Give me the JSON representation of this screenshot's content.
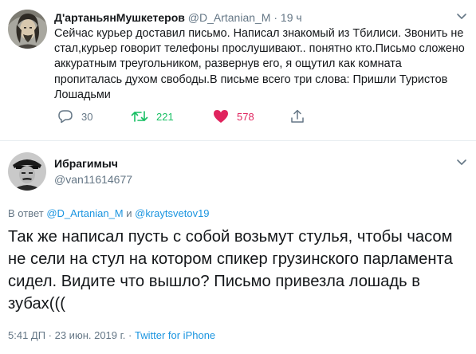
{
  "tweet1": {
    "display_name": "Д'артаньянМушкетеров",
    "handle": "@D_Artanian_M",
    "separator": "·",
    "time": "19 ч",
    "text": "Сейчас курьер доставил письмо. Написал знакомый из Тбилиси. Звонить не стал,курьер говорит телефоны прослушивают.. понятно кто.Письмо сложено аккуратным треугольником, развернув его, я ощутил как комната пропиталась духом свободы.В письме всего три слова: Пришли Туристов Лошадьми",
    "replies": "30",
    "retweets": "221",
    "likes": "578",
    "icons": {
      "reply": "reply-icon",
      "retweet": "retweet-icon",
      "like": "heart-icon",
      "share": "share-icon",
      "menu": "chevron-down-icon"
    },
    "colors": {
      "retweet": "#17bf63",
      "like": "#e0245e",
      "muted": "#657786"
    }
  },
  "tweet2": {
    "display_name": "Ибрагимыч",
    "handle": "@van11614677",
    "reply_prefix": "В ответ",
    "reply_mention1": "@D_Artanian_M",
    "reply_and": "и",
    "reply_mention2": "@kraytsvetov19",
    "text": "Так же написал пусть с собой возьмут стулья, чтобы часом не сели на стул на котором спикер грузинского парламента сидел. Видите что вышло? Письмо привезла лошадь в зубах(((",
    "timestamp": "5:41 ДП · 23 июн. 2019 г.",
    "meta_separator": "·",
    "source": "Twitter for iPhone",
    "colors": {
      "link": "#1b95e0"
    }
  }
}
